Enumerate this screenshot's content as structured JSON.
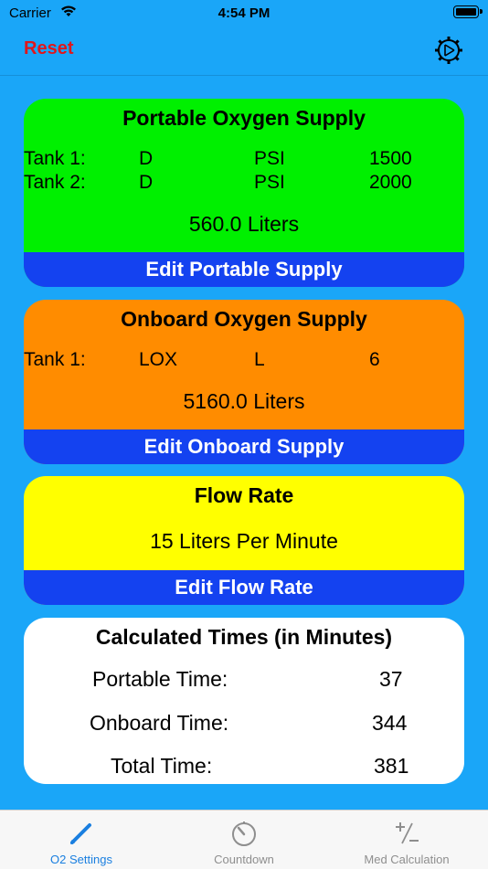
{
  "status_bar": {
    "carrier": "Carrier",
    "time": "4:54 PM"
  },
  "nav": {
    "reset_label": "Reset",
    "settings_icon": "gear-icon"
  },
  "portable": {
    "title": "Portable Oxygen Supply",
    "tanks": [
      {
        "label": "Tank 1:",
        "size": "D",
        "unit": "PSI",
        "value": "1500"
      },
      {
        "label": "Tank 2:",
        "size": "D",
        "unit": "PSI",
        "value": "2000"
      }
    ],
    "total": "560.0 Liters",
    "edit_label": "Edit Portable Supply",
    "color": "#00f000"
  },
  "onboard": {
    "title": "Onboard Oxygen Supply",
    "tanks": [
      {
        "label": "Tank 1:",
        "size": "LOX",
        "unit": "L",
        "value": "6"
      }
    ],
    "total": "5160.0 Liters",
    "edit_label": "Edit Onboard Supply",
    "color": "#ff8c00"
  },
  "flow": {
    "title": "Flow Rate",
    "value": "15 Liters Per Minute",
    "edit_label": "Edit Flow Rate",
    "color": "#ffff00"
  },
  "calc": {
    "title": "Calculated Times (in Minutes)",
    "rows": [
      {
        "label": "Portable Time:",
        "value": "37"
      },
      {
        "label": "Onboard Time:",
        "value": "344"
      },
      {
        "label": "Total Time:",
        "value": "381"
      }
    ]
  },
  "tabs": [
    {
      "label": "O2 Settings",
      "icon": "pencil-icon",
      "active": true
    },
    {
      "label": "Countdown",
      "icon": "timer-icon",
      "active": false
    },
    {
      "label": "Med Calculation",
      "icon": "plus-minus-icon",
      "active": false
    }
  ],
  "colors": {
    "accent": "#1a7fe0",
    "background": "#1aa6f8",
    "edit_button": "#1442f0",
    "reset": "#e0161b"
  }
}
